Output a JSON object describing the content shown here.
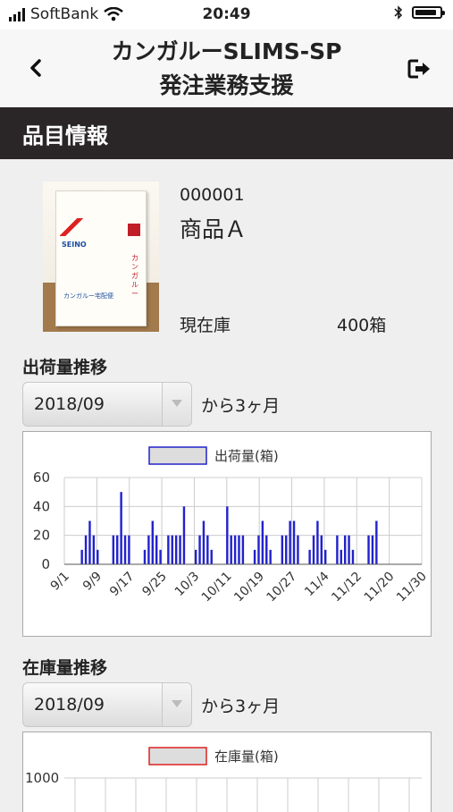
{
  "status_bar": {
    "carrier": "SoftBank",
    "time": "20:49",
    "battery_level": 0.9
  },
  "nav": {
    "title_line1": "カンガルーSLIMS-SP",
    "title_line2": "発注業務支援",
    "back_icon": "chevron-left-icon",
    "logout_icon": "logout-icon"
  },
  "section": {
    "title": "品目情報"
  },
  "product": {
    "code": "000001",
    "name": "商品Ａ",
    "stock_label": "現在庫",
    "stock_value": "400箱"
  },
  "shipment": {
    "title": "出荷量推移",
    "select_value": "2018/09",
    "range_text": "から3ヶ月",
    "chart_data": {
      "type": "bar",
      "series": [
        {
          "name": "出荷量(箱)",
          "color": "#2222cc"
        }
      ],
      "yticks": [
        "0",
        "20",
        "40",
        "60"
      ],
      "ylim": [
        0,
        60
      ],
      "xlabels": [
        "9/1",
        "9/9",
        "9/17",
        "9/25",
        "10/3",
        "10/11",
        "10/19",
        "10/27",
        "11/4",
        "11/12",
        "11/20",
        "11/30"
      ],
      "values": [
        0,
        0,
        0,
        0,
        10,
        20,
        30,
        20,
        10,
        0,
        0,
        0,
        20,
        20,
        50,
        20,
        20,
        0,
        0,
        0,
        10,
        20,
        30,
        20,
        10,
        0,
        20,
        20,
        20,
        20,
        40,
        0,
        0,
        10,
        20,
        30,
        20,
        10,
        0,
        0,
        0,
        40,
        20,
        20,
        20,
        20,
        0,
        0,
        10,
        20,
        30,
        20,
        10,
        0,
        0,
        20,
        20,
        30,
        30,
        20,
        0,
        0,
        10,
        20,
        30,
        20,
        10,
        0,
        0,
        20,
        10,
        20,
        20,
        10,
        0,
        0,
        0,
        20,
        20,
        30,
        0,
        0,
        0,
        0,
        0,
        0,
        0,
        0,
        0,
        0,
        0
      ]
    }
  },
  "inventory": {
    "title": "在庫量推移",
    "select_value": "2018/09",
    "range_text": "から3ヶ月",
    "chart_data": {
      "type": "line",
      "series": [
        {
          "name": "在庫量(箱)",
          "color": "#dd2222"
        }
      ],
      "yticks": [
        "1000"
      ]
    }
  }
}
